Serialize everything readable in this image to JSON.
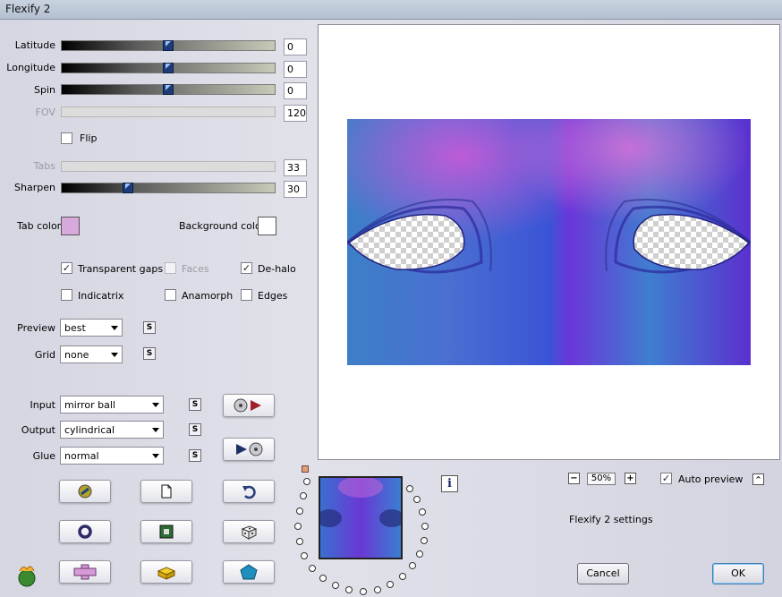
{
  "window": {
    "title": "Flexify 2"
  },
  "params": {
    "latitude": {
      "label": "Latitude",
      "value": "0",
      "fraction": 0.5
    },
    "longitude": {
      "label": "Longitude",
      "value": "0",
      "fraction": 0.5
    },
    "spin": {
      "label": "Spin",
      "value": "0",
      "fraction": 0.5
    },
    "fov": {
      "label": "FOV",
      "value": "120"
    },
    "flip": {
      "label": "Flip",
      "checked": false
    },
    "tabs": {
      "label": "Tabs",
      "value": "33"
    },
    "sharpen": {
      "label": "Sharpen",
      "value": "30",
      "fraction": 0.3
    }
  },
  "colors": {
    "tab_color_label": "Tab color",
    "tab_color": "#d8a9dc",
    "background_color_label": "Background color",
    "background_color": "#ffffff"
  },
  "options": {
    "transparent_gaps": {
      "label": "Transparent gaps",
      "checked": true
    },
    "faces": {
      "label": "Faces",
      "checked": false
    },
    "de_halo": {
      "label": "De-halo",
      "checked": true
    },
    "indicatrix": {
      "label": "Indicatrix",
      "checked": false
    },
    "anamorph": {
      "label": "Anamorph",
      "checked": false
    },
    "edges": {
      "label": "Edges",
      "checked": false
    }
  },
  "selects": {
    "preview": {
      "label": "Preview",
      "value": "best"
    },
    "grid": {
      "label": "Grid",
      "value": "none"
    },
    "input": {
      "label": "Input",
      "value": "mirror ball"
    },
    "output": {
      "label": "Output",
      "value": "cylindrical"
    },
    "glue": {
      "label": "Glue",
      "value": "normal"
    }
  },
  "s_label": "S",
  "zoom": {
    "value": "50%",
    "minus": "−",
    "plus": "+"
  },
  "auto_preview": {
    "label": "Auto preview",
    "checked": true
  },
  "settings_name": "Flexify 2 settings",
  "buttons": {
    "cancel": "Cancel",
    "ok": "OK"
  },
  "icons": {
    "info": "info-icon",
    "up": "chevron-up-icon"
  }
}
